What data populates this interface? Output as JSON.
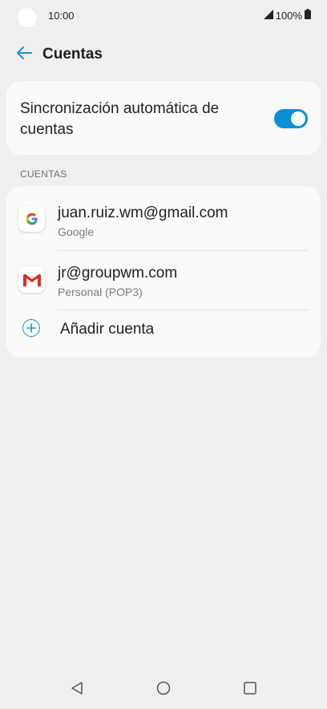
{
  "status_bar": {
    "time": "10:00",
    "battery": "100%",
    "icons": [
      "signal-icon",
      "battery-icon"
    ]
  },
  "app_bar": {
    "title": "Cuentas",
    "back_icon": "back-arrow-icon"
  },
  "sync": {
    "label": "Sincronización automática de cuentas",
    "enabled": true
  },
  "accounts_section": {
    "header": "CUENTAS",
    "items": [
      {
        "name": "juan.ruiz.wm@gmail.com",
        "type": "Google",
        "icon": "google-icon"
      },
      {
        "name": "jr@groupwm.com",
        "type": "Personal (POP3)",
        "icon": "gmail-icon"
      }
    ],
    "add_label": "Añadir cuenta"
  },
  "colors": {
    "accent": "#0a8fd6",
    "background": "#efefef",
    "card": "#fafafa"
  },
  "nav_bar": {
    "icons": [
      "nav-back-icon",
      "nav-home-icon",
      "nav-recent-icon"
    ]
  }
}
